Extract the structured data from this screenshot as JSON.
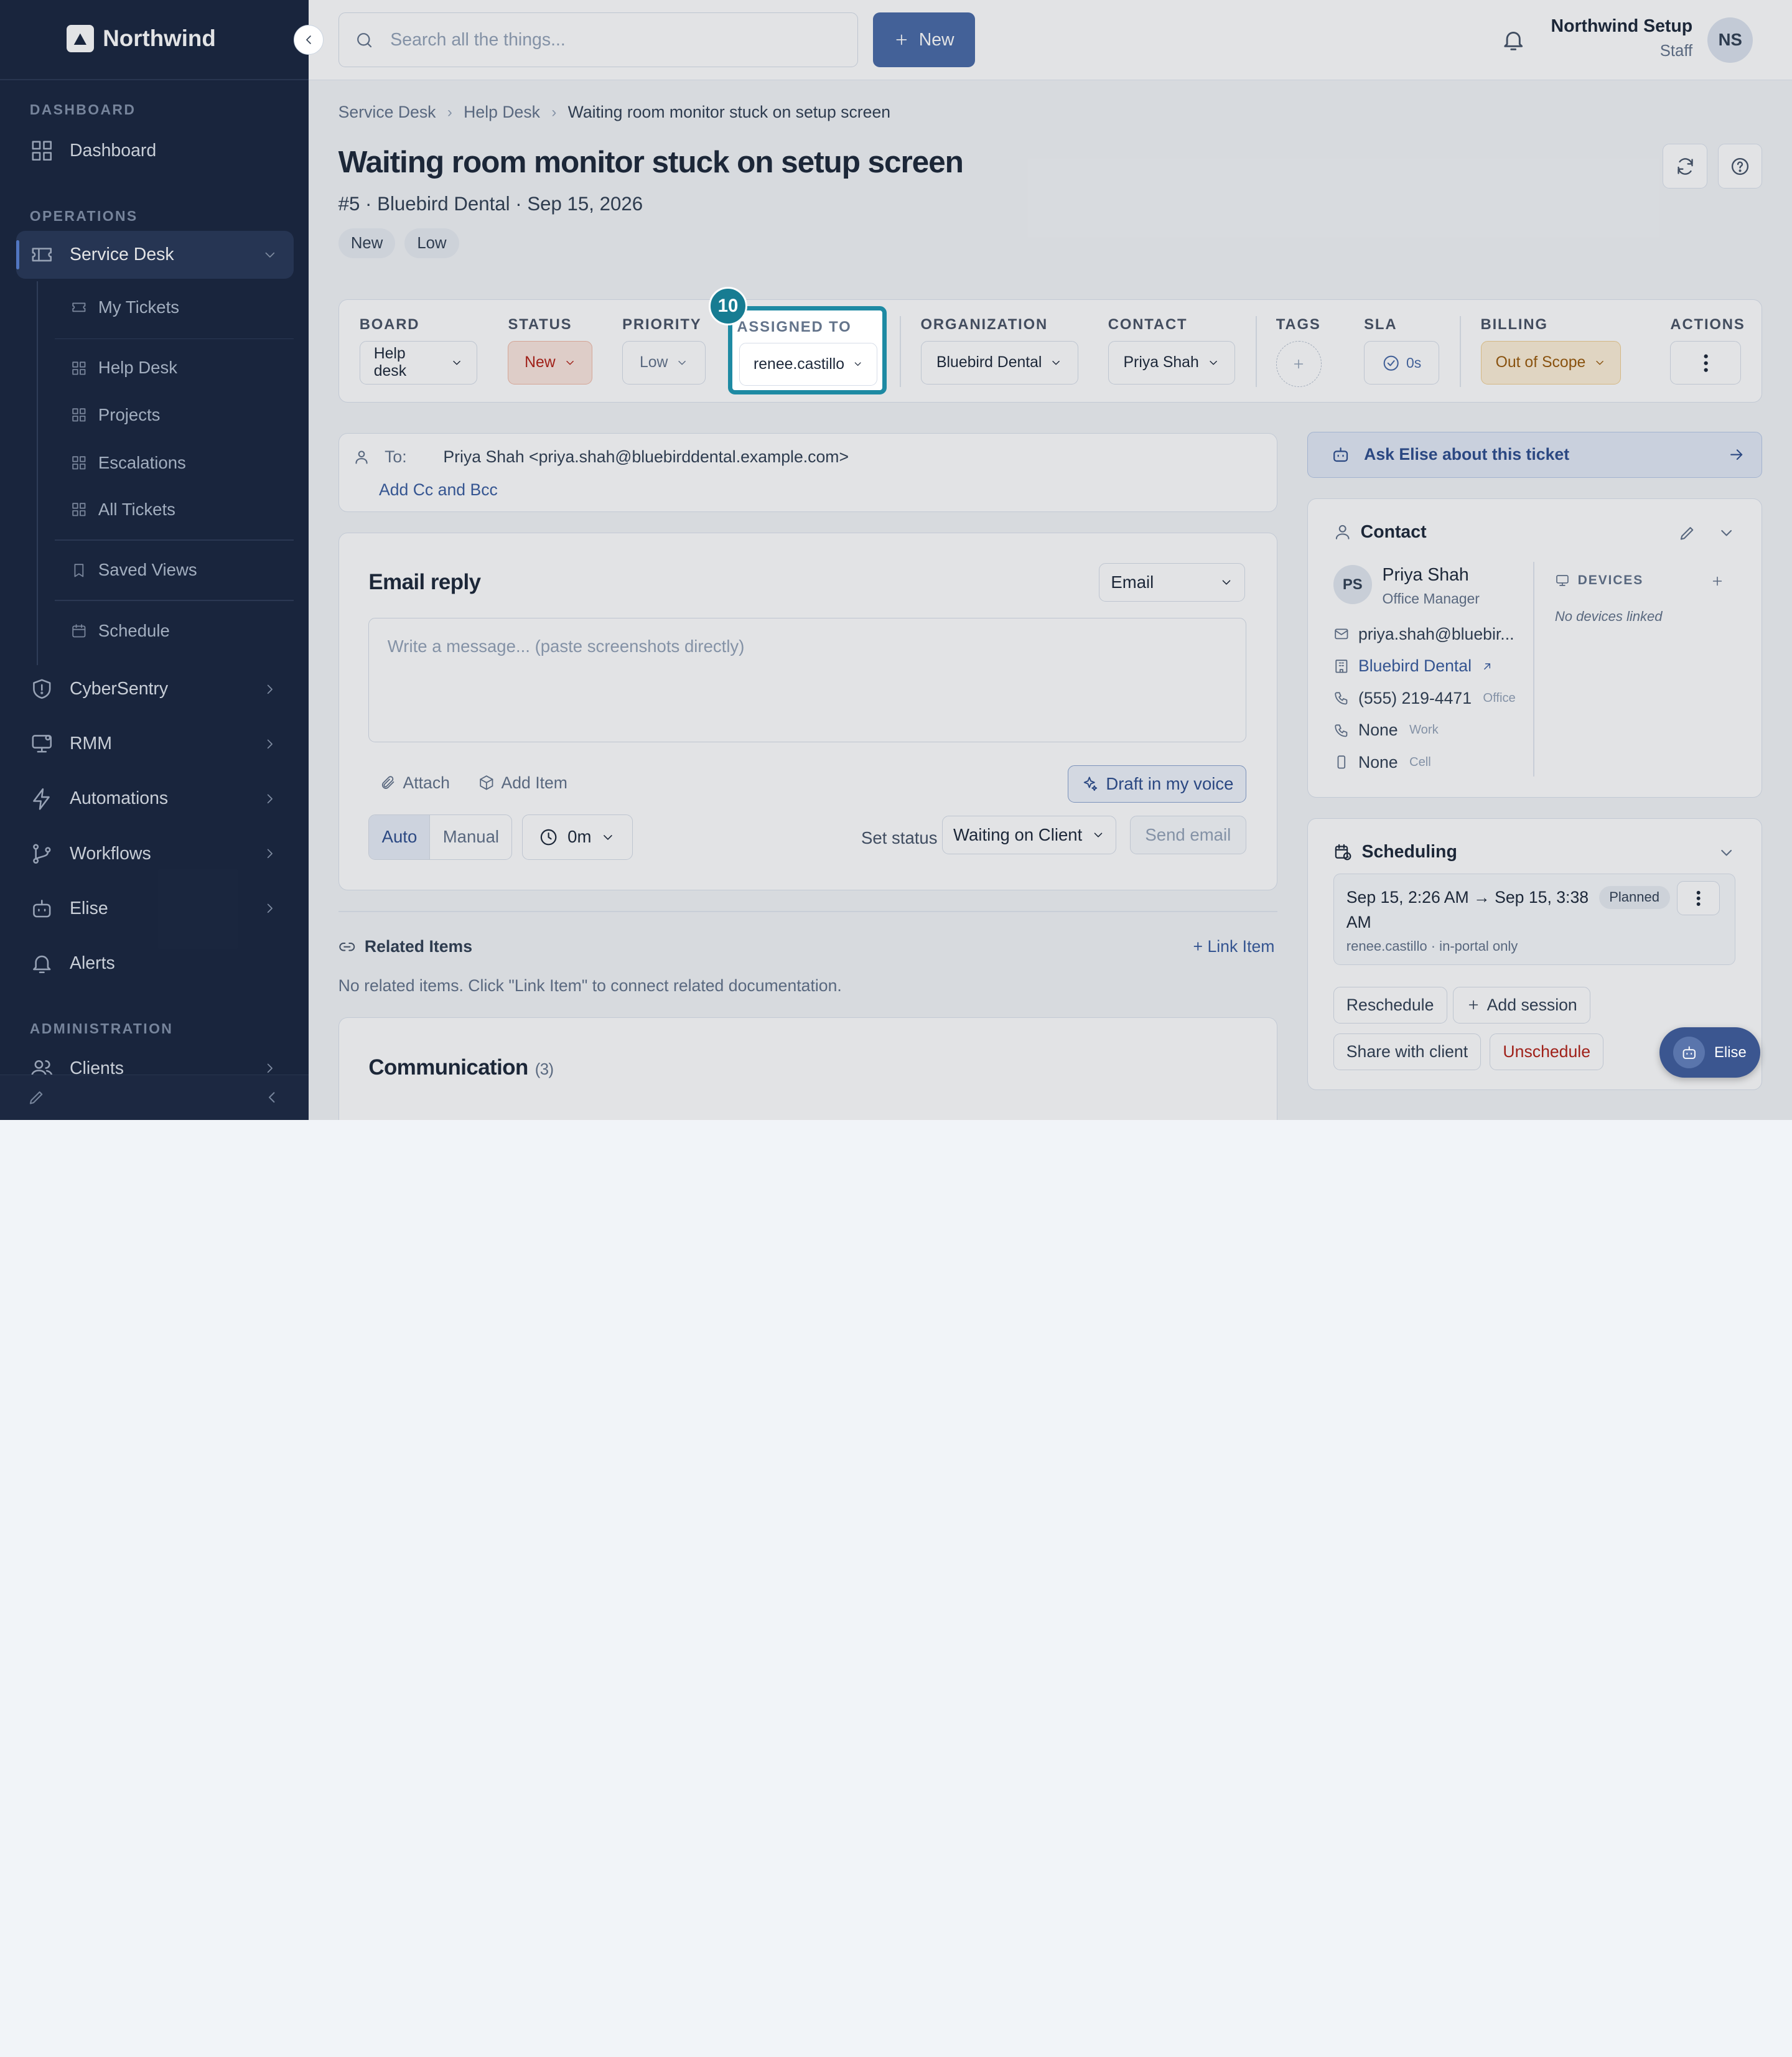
{
  "app": {
    "name": "Northwind"
  },
  "sidebar": {
    "section_dashboard": "DASHBOARD",
    "dashboard": "Dashboard",
    "section_operations": "OPERATIONS",
    "service_desk": "Service Desk",
    "service_desk_children": [
      "My Tickets",
      "Help Desk",
      "Projects",
      "Escalations",
      "All Tickets",
      "Saved Views",
      "Schedule"
    ],
    "cybersentry": "CyberSentry",
    "rmm": "RMM",
    "automations": "Automations",
    "workflows": "Workflows",
    "elise": "Elise",
    "alerts": "Alerts",
    "section_administration": "ADMINISTRATION",
    "clients": "Clients"
  },
  "topbar": {
    "search_placeholder": "Search all the things...",
    "new_label": "New",
    "user_name": "Northwind Setup",
    "user_role": "Staff",
    "user_initials": "NS"
  },
  "breadcrumb": [
    "Service Desk",
    "Help Desk",
    "Waiting room monitor stuck on setup screen"
  ],
  "ticket": {
    "title": "Waiting room monitor stuck on setup screen",
    "subtitle": "#5 · Bluebird Dental · Sep 15, 2026",
    "badges": [
      "New",
      "Low"
    ]
  },
  "fields": {
    "board_label": "BOARD",
    "board_value": "Help desk",
    "status_label": "STATUS",
    "status_value": "New",
    "priority_label": "PRIORITY",
    "priority_value": "Low",
    "assigned_label": "ASSIGNED TO",
    "assigned_value": "renee.castillo",
    "org_label": "ORGANIZATION",
    "org_value": "Bluebird Dental",
    "contact_label": "CONTACT",
    "contact_value": "Priya Shah",
    "tags_label": "TAGS",
    "sla_label": "SLA",
    "sla_value": "0s",
    "billing_label": "BILLING",
    "billing_value": "Out of Scope",
    "actions_label": "ACTIONS"
  },
  "step_marker": "10",
  "recipients": {
    "to_label": "To:",
    "to_value": "Priya Shah <priya.shah@bluebirddental.example.com>",
    "add_cc": "Add Cc and Bcc"
  },
  "reply": {
    "title": "Email reply",
    "mode": "Email",
    "placeholder": "Write a message... (paste screenshots directly)",
    "attach": "Attach",
    "add_item": "Add Item",
    "draft": "Draft in my voice",
    "auto": "Auto",
    "manual": "Manual",
    "timer": "0m",
    "set_status_label": "Set status",
    "status_value": "Waiting on Client",
    "send": "Send email"
  },
  "related": {
    "title": "Related Items",
    "link": "+ Link Item",
    "empty": "No related items. Click \"Link Item\" to connect related documentation."
  },
  "communication": {
    "title": "Communication",
    "count": "(3)"
  },
  "ask_elise": "Ask Elise about this ticket",
  "contact_card": {
    "title": "Contact",
    "initials": "PS",
    "name": "Priya Shah",
    "role": "Office Manager",
    "email": "priya.shah@bluebir...",
    "org": "Bluebird Dental",
    "phone": "(555) 219-4471",
    "phone_type": "Office",
    "work": "None",
    "work_type": "Work",
    "cell": "None",
    "cell_type": "Cell",
    "devices_label": "DEVICES",
    "devices_empty": "No devices linked"
  },
  "scheduling": {
    "title": "Scheduling",
    "session_time": "Sep 15, 2:26 AM → Sep 15, 3:38 AM",
    "session_sub": "renee.castillo · in-portal only",
    "status": "Planned",
    "reschedule": "Reschedule",
    "add_session": "Add session",
    "share": "Share with client",
    "unschedule": "Unschedule"
  },
  "fab": {
    "label": "Elise"
  },
  "colors": {
    "sidebar": "#1b2740",
    "accent": "#4a6ca8",
    "highlight": "#1e8aa3",
    "danger": "#b42318"
  }
}
